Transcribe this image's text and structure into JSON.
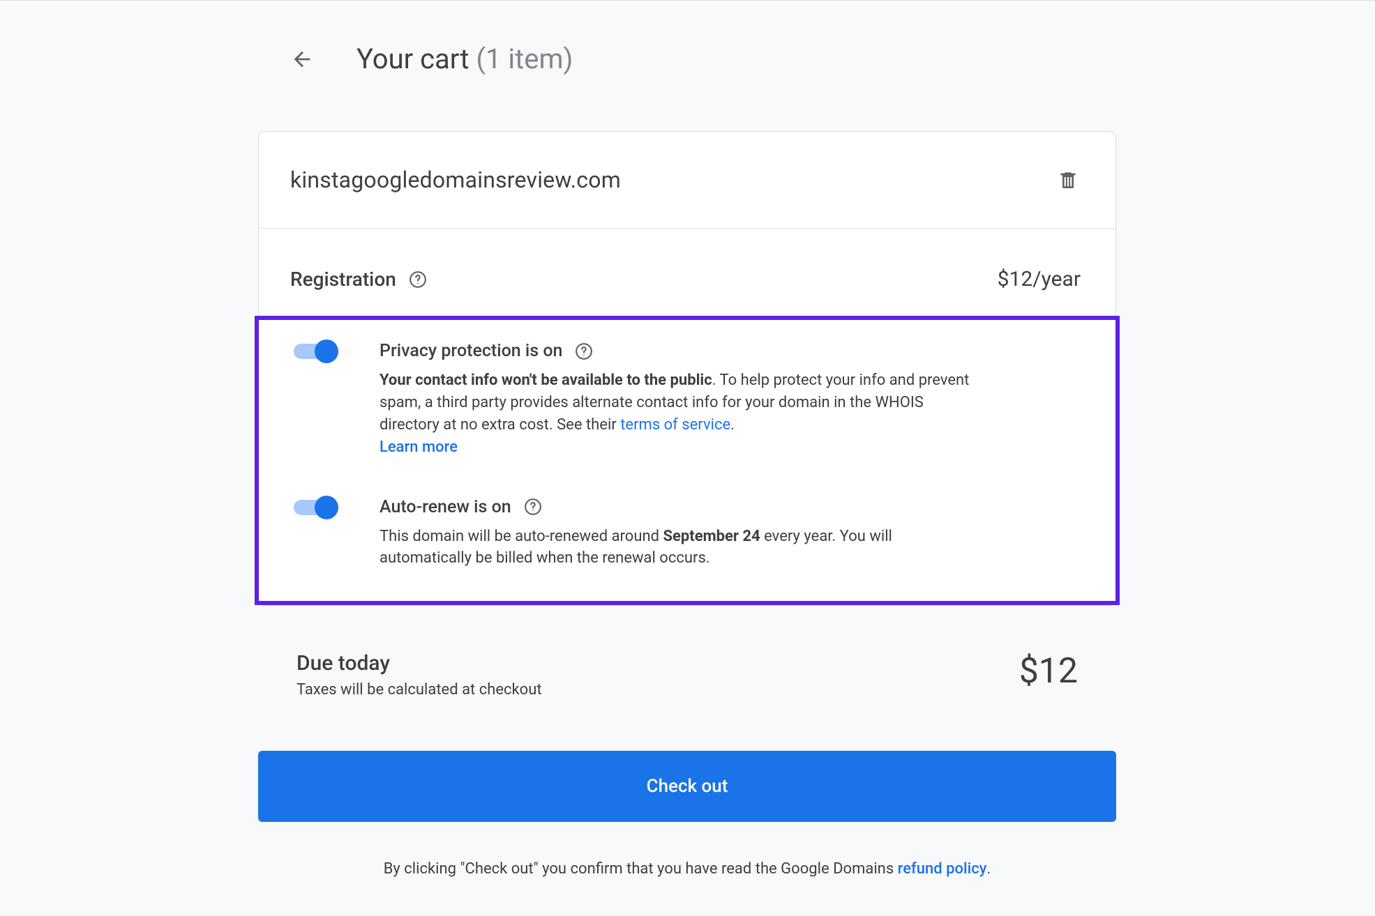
{
  "header": {
    "title_prefix": "Your cart ",
    "title_count": "(1 item)"
  },
  "cart": {
    "domain": "kinstagoogledomainsreview.com",
    "registration_label": "Registration",
    "price": "$12/year",
    "privacy": {
      "title": "Privacy protection is on",
      "bold_intro": "Your contact info won't be available to the public",
      "rest1": ". To help protect your info and prevent spam, a third party provides alternate contact info for your domain in the WHOIS directory at no extra cost. See their ",
      "tos_link": "terms of service",
      "period": ".",
      "learn_more": "Learn more"
    },
    "autorenew": {
      "title": "Auto-renew is on",
      "pre": "This domain will be auto-renewed around ",
      "date": "September 24",
      "post": " every year. You will automatically be billed when the renewal occurs."
    }
  },
  "due": {
    "label": "Due today",
    "tax_note": "Taxes will be calculated at checkout",
    "amount": "$12"
  },
  "checkout_label": "Check out",
  "disclaimer": {
    "pre": "By clicking \"Check out\" you confirm that you have read the Google Domains ",
    "link": "refund policy",
    "post": "."
  }
}
